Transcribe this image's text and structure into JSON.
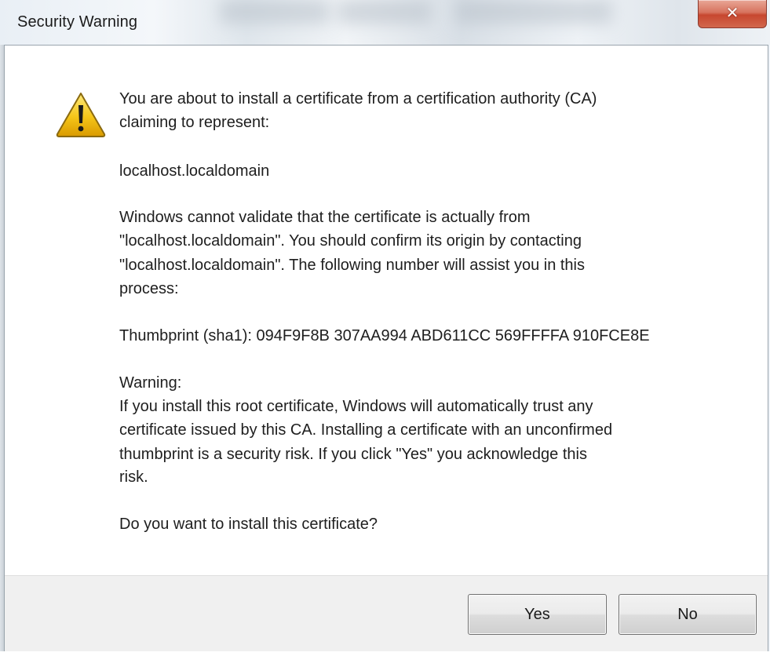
{
  "window": {
    "title": "Security Warning",
    "close_glyph": "✕"
  },
  "icon": "warning-triangle-icon",
  "colors": {
    "warning_yellow": "#f5c518",
    "close_red": "#c7472f",
    "footer_bg": "#f0f0f0"
  },
  "message": {
    "line1": "You are about to install a certificate from a certification authority (CA)",
    "line2": "claiming to represent:",
    "host": "localhost.localdomain",
    "validate1": "Windows cannot validate that the certificate is actually from",
    "validate2": "\"localhost.localdomain\". You should confirm its origin by contacting",
    "validate3": "\"localhost.localdomain\". The following number will assist you in this",
    "validate4": "process:",
    "thumbprint": "Thumbprint (sha1): 094F9F8B 307AA994 ABD611CC 569FFFFA 910FCE8E",
    "warning_head": "Warning:",
    "warning1": "If you install this root certificate, Windows will automatically trust any",
    "warning2": "certificate issued by this CA. Installing a certificate with an unconfirmed",
    "warning3": "thumbprint is a security risk. If you click \"Yes\" you acknowledge this",
    "warning4": "risk.",
    "question": "Do you want to install this certificate?"
  },
  "buttons": {
    "yes": "Yes",
    "no": "No"
  }
}
